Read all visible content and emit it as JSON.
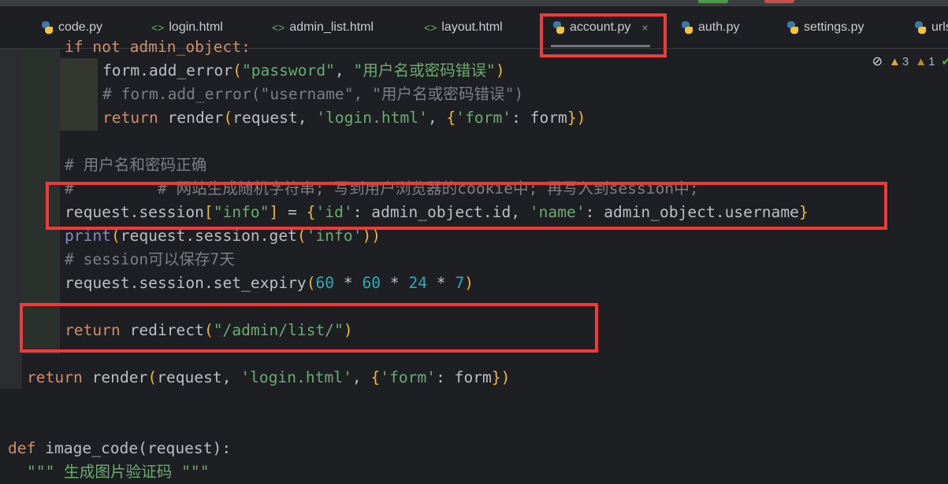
{
  "tabs": [
    {
      "label": "code.py",
      "icon": "python-icon"
    },
    {
      "label": "login.html",
      "icon": "html-icon"
    },
    {
      "label": "admin_list.html",
      "icon": "html-icon"
    },
    {
      "label": "layout.html",
      "icon": "html-icon"
    },
    {
      "label": "account.py",
      "icon": "python-icon",
      "active": true
    },
    {
      "label": "auth.py",
      "icon": "python-icon"
    },
    {
      "label": "settings.py",
      "icon": "python-icon"
    },
    {
      "label": "urls.py",
      "icon": "python-icon"
    }
  ],
  "tab_close_glyph": "×",
  "html_glyph": "<>",
  "inspections": {
    "hide_icon": "eye-crossed-icon",
    "warnings": "3",
    "weak_warnings": "1",
    "ok_icon": "check-icon"
  },
  "highlight_color": "#f23a3a",
  "code_lines": [
    {
      "indent": 6,
      "tokens": [
        [
          "if not admin_object:",
          "kw"
        ]
      ]
    },
    {
      "indent": 10,
      "tokens": [
        [
          "form.add_error",
          ""
        ],
        [
          "(",
          "br"
        ],
        [
          "\"password\"",
          "str"
        ],
        [
          ", ",
          ""
        ],
        [
          "\"用户名或密码错误\"",
          "str"
        ],
        [
          ")",
          "br"
        ]
      ]
    },
    {
      "indent": 10,
      "tokens": [
        [
          "# form.add_error(\"username\", \"用户名或密码错误\")",
          "cm"
        ]
      ]
    },
    {
      "indent": 10,
      "tokens": [
        [
          "return ",
          "kw"
        ],
        [
          "render",
          ""
        ],
        [
          "(",
          "br"
        ],
        [
          "request, ",
          ""
        ],
        [
          "'login.html'",
          "str"
        ],
        [
          ", ",
          ""
        ],
        [
          "{",
          "br"
        ],
        [
          "'form'",
          "str"
        ],
        [
          ": form",
          ""
        ],
        [
          "}",
          "br"
        ],
        [
          ")",
          "br"
        ]
      ]
    },
    {
      "indent": 0,
      "tokens": []
    },
    {
      "indent": 6,
      "tokens": [
        [
          "# 用户名和密码正确",
          "cm"
        ]
      ]
    },
    {
      "indent": 6,
      "tokens": [
        [
          "#         # 网站生成随机字符串; 写到用户浏览器的cookie中; 再写入到session中;",
          "cm"
        ]
      ]
    },
    {
      "indent": 6,
      "tokens": [
        [
          "request.session",
          ""
        ],
        [
          "[",
          "br"
        ],
        [
          "\"info\"",
          "str"
        ],
        [
          "]",
          "br"
        ],
        [
          " = ",
          ""
        ],
        [
          "{",
          "br"
        ],
        [
          "'id'",
          "str"
        ],
        [
          ": admin_object.id, ",
          ""
        ],
        [
          "'name'",
          "str"
        ],
        [
          ": admin_object.username",
          ""
        ],
        [
          "}",
          "br"
        ]
      ]
    },
    {
      "indent": 6,
      "tokens": [
        [
          "print",
          "bi"
        ],
        [
          "(",
          "br"
        ],
        [
          "request.session.get",
          ""
        ],
        [
          "(",
          "br"
        ],
        [
          "'info'",
          "str"
        ],
        [
          "))",
          "br"
        ]
      ]
    },
    {
      "indent": 6,
      "tokens": [
        [
          "# session可以保存7天",
          "cm"
        ]
      ]
    },
    {
      "indent": 6,
      "tokens": [
        [
          "request.session.set_expiry",
          ""
        ],
        [
          "(",
          "br"
        ],
        [
          "60",
          "num"
        ],
        [
          " * ",
          ""
        ],
        [
          "60",
          "num"
        ],
        [
          " * ",
          ""
        ],
        [
          "24",
          "num"
        ],
        [
          " * ",
          ""
        ],
        [
          "7",
          "num"
        ],
        [
          ")",
          "br"
        ]
      ]
    },
    {
      "indent": 0,
      "tokens": []
    },
    {
      "indent": 6,
      "tokens": [
        [
          "return ",
          "kw"
        ],
        [
          "redirect",
          ""
        ],
        [
          "(",
          "br"
        ],
        [
          "\"/admin/list/\"",
          "str"
        ],
        [
          ")",
          "br"
        ]
      ]
    },
    {
      "indent": 0,
      "tokens": []
    },
    {
      "indent": 2,
      "tokens": [
        [
          "return ",
          "kw"
        ],
        [
          "render",
          ""
        ],
        [
          "(",
          "br"
        ],
        [
          "request, ",
          ""
        ],
        [
          "'login.html'",
          "str"
        ],
        [
          ", ",
          ""
        ],
        [
          "{",
          "br"
        ],
        [
          "'form'",
          "str"
        ],
        [
          ": form",
          ""
        ],
        [
          "}",
          "br"
        ],
        [
          ")",
          "br"
        ]
      ]
    },
    {
      "indent": 0,
      "tokens": []
    },
    {
      "indent": 0,
      "tokens": []
    },
    {
      "indent": 0,
      "tokens": [
        [
          "def ",
          "kw"
        ],
        [
          "image_code",
          ""
        ],
        [
          "(request):",
          ""
        ]
      ]
    },
    {
      "indent": 2,
      "tokens": [
        [
          "\"\"\" 生成图片验证码 \"\"\"",
          "str"
        ]
      ]
    }
  ]
}
